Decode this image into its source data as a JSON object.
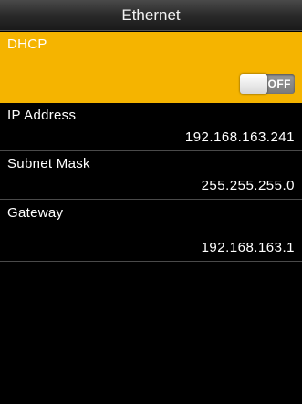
{
  "header": {
    "title": "Ethernet"
  },
  "rows": {
    "dhcp": {
      "label": "DHCP",
      "toggle_state": "OFF",
      "enabled": false
    },
    "ip_address": {
      "label": "IP Address",
      "value": "192.168.163.241"
    },
    "subnet_mask": {
      "label": "Subnet Mask",
      "value": "255.255.255.0"
    },
    "gateway": {
      "label": "Gateway",
      "value": "192.168.163.1"
    }
  },
  "colors": {
    "selected_row": "#f5b400",
    "background": "#000000",
    "divider": "#4a4a4a"
  }
}
